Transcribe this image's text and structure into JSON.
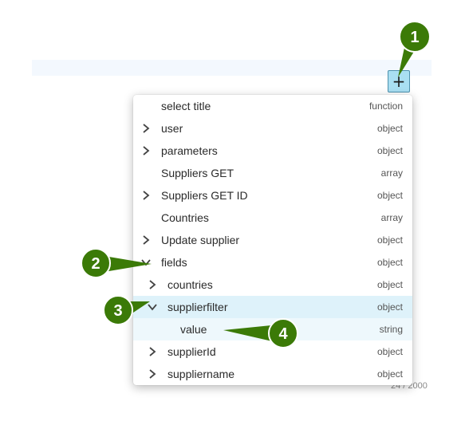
{
  "add_button": {
    "symbol": "+"
  },
  "char_counter": "24 / 2000",
  "menu_items": [
    {
      "label": "select title",
      "type": "function",
      "expand": "none"
    },
    {
      "label": "user",
      "type": "object",
      "expand": "collapsed"
    },
    {
      "label": "parameters",
      "type": "object",
      "expand": "collapsed"
    },
    {
      "label": "Suppliers GET",
      "type": "array",
      "expand": "none"
    },
    {
      "label": "Suppliers GET ID",
      "type": "object",
      "expand": "collapsed"
    },
    {
      "label": "Countries",
      "type": "array",
      "expand": "none"
    },
    {
      "label": "Update supplier",
      "type": "object",
      "expand": "collapsed"
    },
    {
      "label": "fields",
      "type": "object",
      "expand": "expanded"
    },
    {
      "label": "countries",
      "type": "object",
      "expand": "collapsed"
    },
    {
      "label": "supplierfilter",
      "type": "object",
      "expand": "expanded",
      "state": "hover"
    },
    {
      "label": "value",
      "type": "string",
      "expand": "none",
      "state": "selected"
    },
    {
      "label": "supplierId",
      "type": "object",
      "expand": "collapsed"
    },
    {
      "label": "suppliername",
      "type": "object",
      "expand": "collapsed"
    }
  ],
  "callouts": [
    "1",
    "2",
    "3",
    "4"
  ],
  "colors": {
    "callout_fill": "#3b7a07",
    "highlight_row": "#def2fa",
    "selected_row": "#eef8fc",
    "add_button_fill": "#a9dff2"
  }
}
